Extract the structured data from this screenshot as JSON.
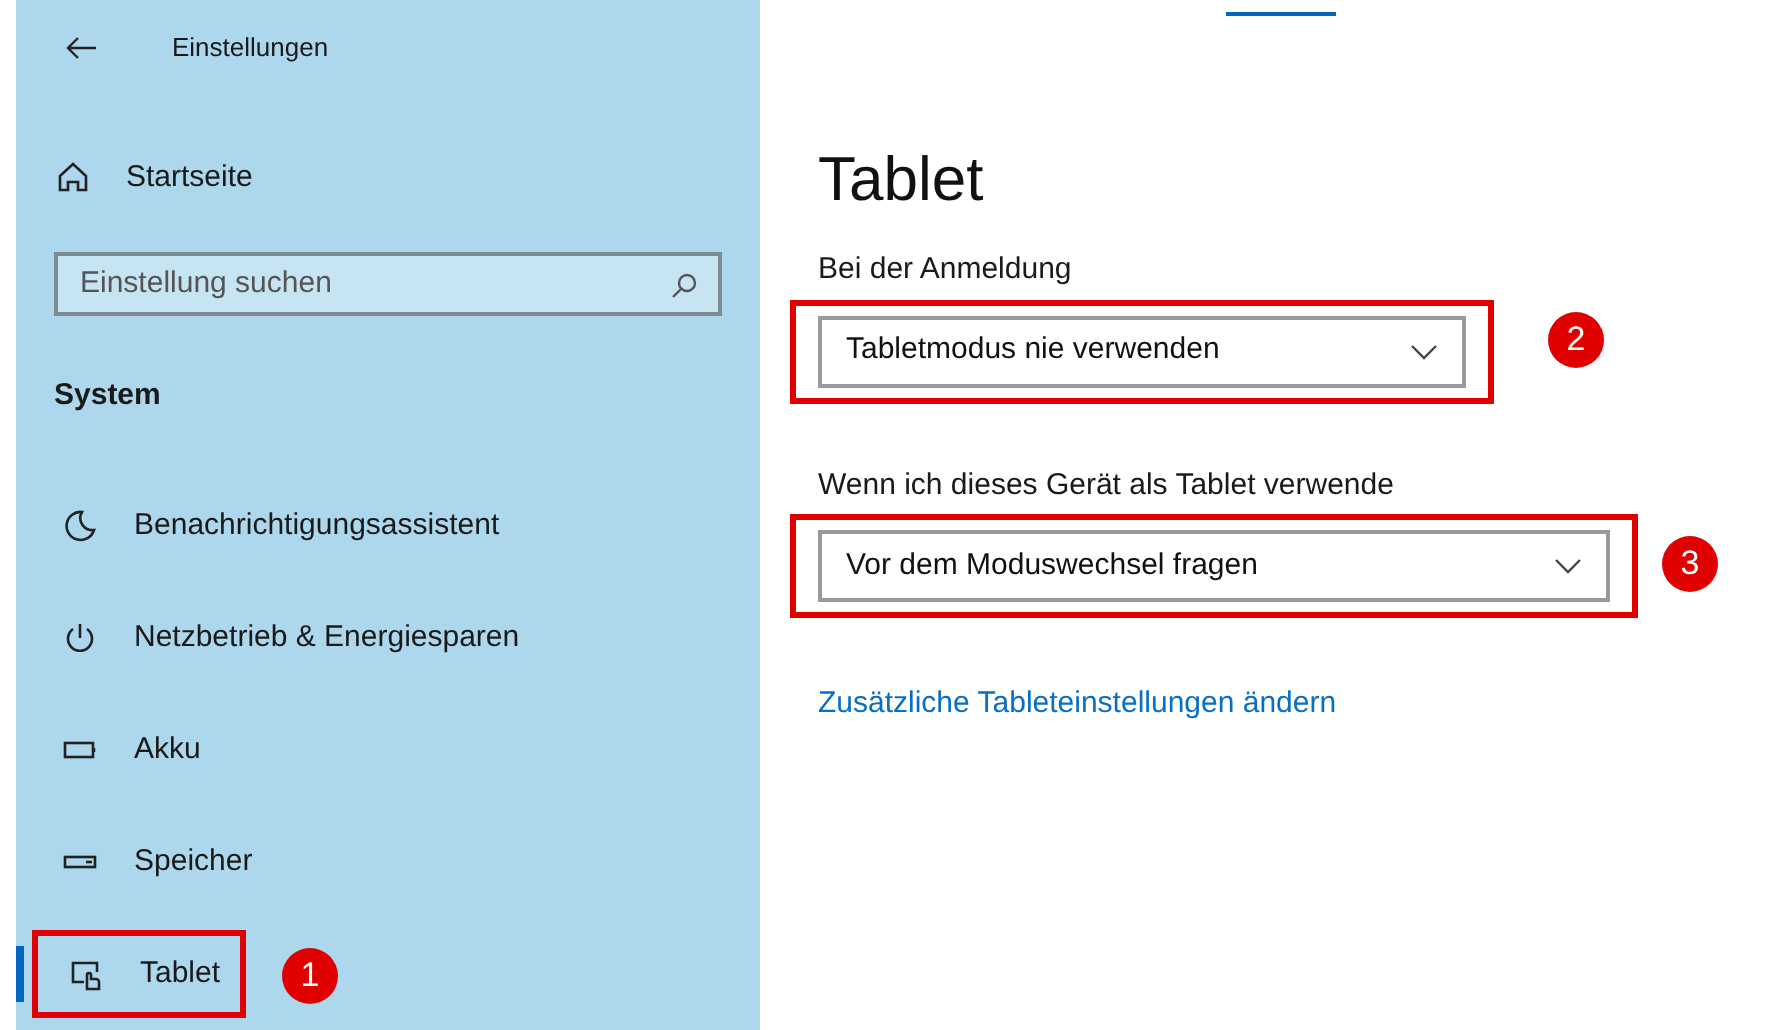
{
  "window": {
    "title": "Einstellungen"
  },
  "sidebar": {
    "home": "Startseite",
    "search": {
      "placeholder": "Einstellung suchen"
    },
    "section": "System",
    "items": [
      {
        "label": "Benachrichtigungsassistent",
        "kind": "moon",
        "selected": false
      },
      {
        "label": "Netzbetrieb & Energiesparen",
        "kind": "power",
        "selected": false
      },
      {
        "label": "Akku",
        "kind": "battery",
        "selected": false
      },
      {
        "label": "Speicher",
        "kind": "storage",
        "selected": false
      },
      {
        "label": "Tablet",
        "kind": "tablet",
        "selected": true,
        "callout": "1"
      }
    ]
  },
  "page": {
    "title": "Tablet",
    "settings": [
      {
        "label": "Bei der Anmeldung",
        "value": "Tabletmodus nie verwenden",
        "callout": "2"
      },
      {
        "label": "Wenn ich dieses Gerät als Tablet verwende",
        "value": "Vor dem Moduswechsel fragen",
        "callout": "3"
      }
    ],
    "link": "Zusätzliche Tableteinstellungen ändern"
  }
}
